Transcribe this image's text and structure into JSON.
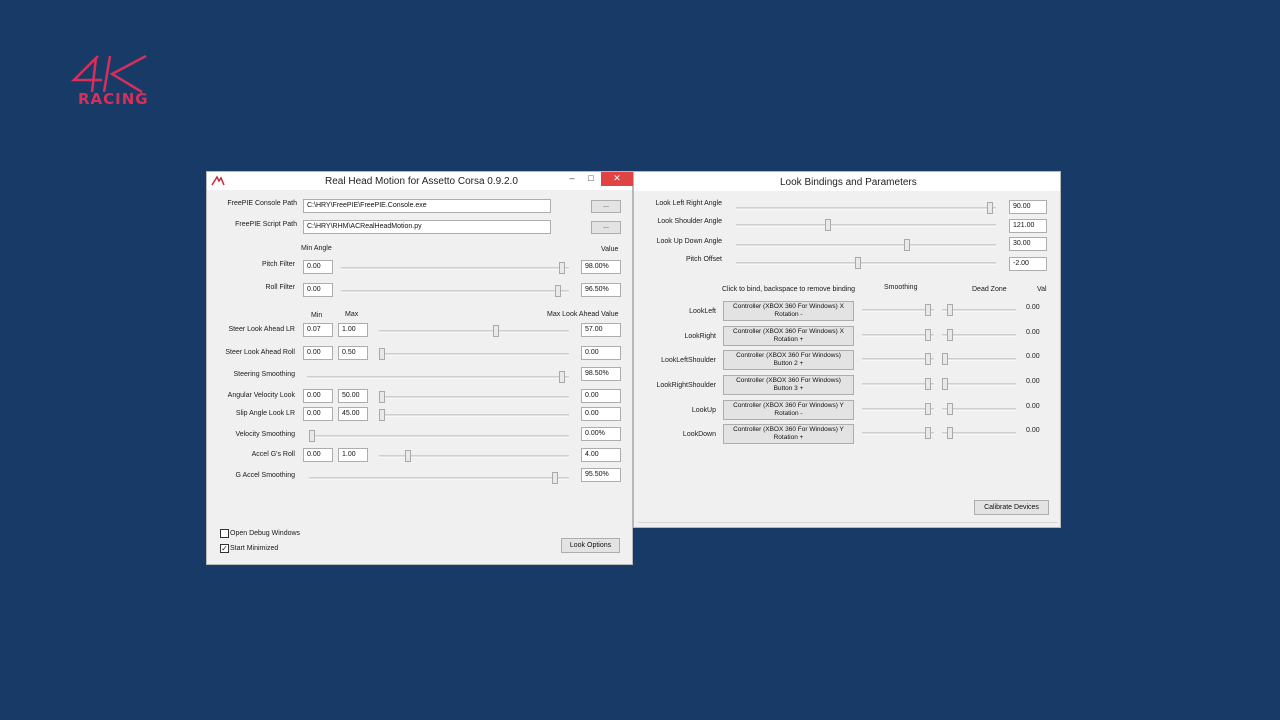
{
  "logo": {
    "mark": "4K",
    "text": "RACING",
    "color": "#d6305a"
  },
  "main_window": {
    "title": "Real Head Motion for Assetto Corsa 0.9.2.0",
    "controls": {
      "minimize": "–",
      "maximize": "□",
      "close": "✕"
    },
    "freepie_console": {
      "label": "FreePIE Console Path",
      "value": "C:\\HRY\\FreePIE\\FreePIE.Console.exe",
      "browse": "..."
    },
    "freepie_script": {
      "label": "FreePIE Script Path",
      "value": "C:\\HRY\\RHM\\ACRealHeadMotion.py",
      "browse": "..."
    },
    "min_angle_header": "Min Angle",
    "value_header": "Value",
    "pitch_filter": {
      "label": "Pitch Filter",
      "min": "0.00",
      "slider": 0.98,
      "value": "98.00%"
    },
    "roll_filter": {
      "label": "Roll Filter",
      "min": "0.00",
      "slider": 0.965,
      "value": "96.50%"
    },
    "min_header": "Min",
    "max_header": "Max",
    "max_look_header": "Max Look Ahead Value",
    "steer_look_lr": {
      "label": "Steer Look Ahead LR",
      "min": "0.07",
      "max": "1.00",
      "slider": 0.62,
      "value": "57.00"
    },
    "steer_look_roll": {
      "label": "Steer Look Ahead Roll",
      "min": "0.00",
      "max": "0.50",
      "slider": 0.0,
      "value": "0.00"
    },
    "steering_smoothing": {
      "label": "Steering Smoothing",
      "slider": 0.985,
      "value": "98.50%"
    },
    "angular_velocity": {
      "label": "Angular Velocity Look",
      "min": "0.00",
      "max": "50.00",
      "slider": 0.0,
      "value": "0.00"
    },
    "slip_angle": {
      "label": "Slip Angle Look LR",
      "min": "0.00",
      "max": "45.00",
      "slider": 0.0,
      "value": "0.00"
    },
    "velocity_smoothing": {
      "label": "Velocity Smoothing",
      "slider": 0.0,
      "value": "0.00%"
    },
    "accel_roll": {
      "label": "Accel G's  Roll",
      "min": "0.00",
      "max": "1.00",
      "slider": 0.14,
      "value": "4.00"
    },
    "g_accel_smoothing": {
      "label": "G Accel Smoothing",
      "slider": 0.955,
      "value": "95.50%"
    },
    "open_debug": {
      "label": "Open Debug Windows",
      "checked": false
    },
    "start_minimized": {
      "label": "Start Minimized",
      "checked": true
    },
    "look_options": "Look Options"
  },
  "bind_window": {
    "title": "Look Bindings and Parameters",
    "params": [
      {
        "label": "Look Left Right Angle",
        "slider": 0.99,
        "value": "90.00"
      },
      {
        "label": "Look Shoulder Angle",
        "slider": 0.35,
        "value": "121.00"
      },
      {
        "label": "Look Up Down Angle",
        "slider": 0.66,
        "value": "30.00"
      },
      {
        "label": "Pitch Offset",
        "slider": 0.47,
        "value": "-2.00"
      }
    ],
    "bind_header": "Click to bind, backspace to remove binding",
    "smoothing_header": "Smoothing",
    "deadzone_header": "Dead Zone",
    "val_header": "Val",
    "bindings": [
      {
        "label": "LookLeft",
        "line1": "Controller (XBOX 360 For Windows) X",
        "line2": "Rotation -",
        "smoothing": 0.95,
        "deadzone": 0.07,
        "value": "0.00"
      },
      {
        "label": "LookRight",
        "line1": "Controller (XBOX 360 For Windows) X",
        "line2": "Rotation +",
        "smoothing": 0.95,
        "deadzone": 0.07,
        "value": "0.00"
      },
      {
        "label": "LookLeftShoulder",
        "line1": "Controller (XBOX 360 For Windows)",
        "line2": "Button 2 +",
        "smoothing": 0.95,
        "deadzone": 0.0,
        "value": "0.00"
      },
      {
        "label": "LookRightShoulder",
        "line1": "Controller (XBOX 360 For Windows)",
        "line2": "Button 3 +",
        "smoothing": 0.95,
        "deadzone": 0.0,
        "value": "0.00"
      },
      {
        "label": "LookUp",
        "line1": "Controller (XBOX 360 For Windows) Y",
        "line2": "Rotation -",
        "smoothing": 0.95,
        "deadzone": 0.08,
        "value": "0.00"
      },
      {
        "label": "LookDown",
        "line1": "Controller (XBOX 360 For Windows) Y",
        "line2": "Rotation +",
        "smoothing": 0.95,
        "deadzone": 0.08,
        "value": "0.00"
      }
    ],
    "calibrate": "Calibrate Devices"
  }
}
